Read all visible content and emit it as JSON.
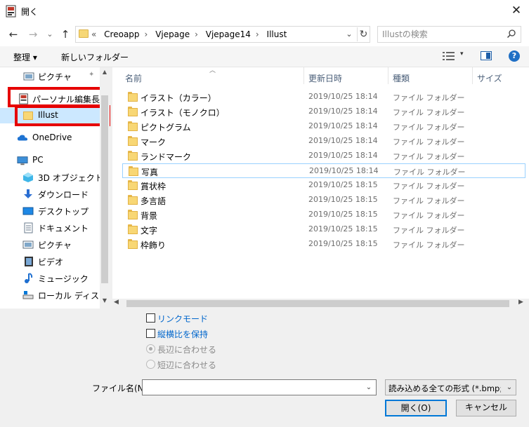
{
  "window": {
    "title": "開く",
    "close_glyph": "✕"
  },
  "nav": {
    "back": "←",
    "forward": "→",
    "down": "⌄",
    "up": "↑",
    "path": [
      "«",
      "Creoapp",
      "Vjepage",
      "Vjepage14",
      "Illust"
    ],
    "dropdown": "⌄",
    "refresh": "↻",
    "search_placeholder": "Illustの検索"
  },
  "toolbar": {
    "organize": "整理 ▾",
    "new_folder": "新しいフォルダー",
    "view_dropdown": "▾",
    "help": "?"
  },
  "sidebar": {
    "items": [
      {
        "label": "ピクチャ",
        "icon": "pictures-icon",
        "pin": "✦"
      },
      {
        "label": "パーソナル編集長",
        "icon": "app-icon"
      },
      {
        "label": "Illust",
        "icon": "folder-icon"
      },
      {
        "label": "OneDrive",
        "icon": "cloud-icon"
      },
      {
        "label": "PC",
        "icon": "pc-icon"
      },
      {
        "label": "3D オブジェクト",
        "icon": "cube-icon"
      },
      {
        "label": "ダウンロード",
        "icon": "download-icon"
      },
      {
        "label": "デスクトップ",
        "icon": "desktop-icon"
      },
      {
        "label": "ドキュメント",
        "icon": "document-icon"
      },
      {
        "label": "ピクチャ",
        "icon": "pictures-icon"
      },
      {
        "label": "ビデオ",
        "icon": "video-icon"
      },
      {
        "label": "ミュージック",
        "icon": "music-icon"
      },
      {
        "label": "ローカル ディスク (C",
        "icon": "disk-icon"
      }
    ]
  },
  "columns": {
    "name": "名前",
    "date": "更新日時",
    "type": "種類",
    "size": "サイズ"
  },
  "files": [
    {
      "name": "イラスト（カラー）",
      "date": "2019/10/25 18:14",
      "type": "ファイル フォルダー"
    },
    {
      "name": "イラスト（モノクロ）",
      "date": "2019/10/25 18:14",
      "type": "ファイル フォルダー"
    },
    {
      "name": "ピクトグラム",
      "date": "2019/10/25 18:14",
      "type": "ファイル フォルダー"
    },
    {
      "name": "マーク",
      "date": "2019/10/25 18:14",
      "type": "ファイル フォルダー"
    },
    {
      "name": "ランドマーク",
      "date": "2019/10/25 18:14",
      "type": "ファイル フォルダー"
    },
    {
      "name": "写真",
      "date": "2019/10/25 18:14",
      "type": "ファイル フォルダー"
    },
    {
      "name": "賞状枠",
      "date": "2019/10/25 18:15",
      "type": "ファイル フォルダー"
    },
    {
      "name": "多言語",
      "date": "2019/10/25 18:15",
      "type": "ファイル フォルダー"
    },
    {
      "name": "背景",
      "date": "2019/10/25 18:15",
      "type": "ファイル フォルダー"
    },
    {
      "name": "文字",
      "date": "2019/10/25 18:15",
      "type": "ファイル フォルダー"
    },
    {
      "name": "枠飾り",
      "date": "2019/10/25 18:15",
      "type": "ファイル フォルダー"
    }
  ],
  "options": {
    "link_mode": "リンクモード",
    "keep_ratio": "縦横比を保持",
    "fit_long": "長辺に合わせる",
    "fit_short": "短辺に合わせる"
  },
  "bottom": {
    "filename_label": "ファイル名(N):",
    "filename_value": "",
    "filetype": "読み込める全ての形式 (*.bmp;*.c",
    "open": "開く(O)",
    "cancel": "キャンセル"
  },
  "colors": {
    "accent": "#0078d7",
    "highlight": "#e60000",
    "link": "#0066cc"
  }
}
